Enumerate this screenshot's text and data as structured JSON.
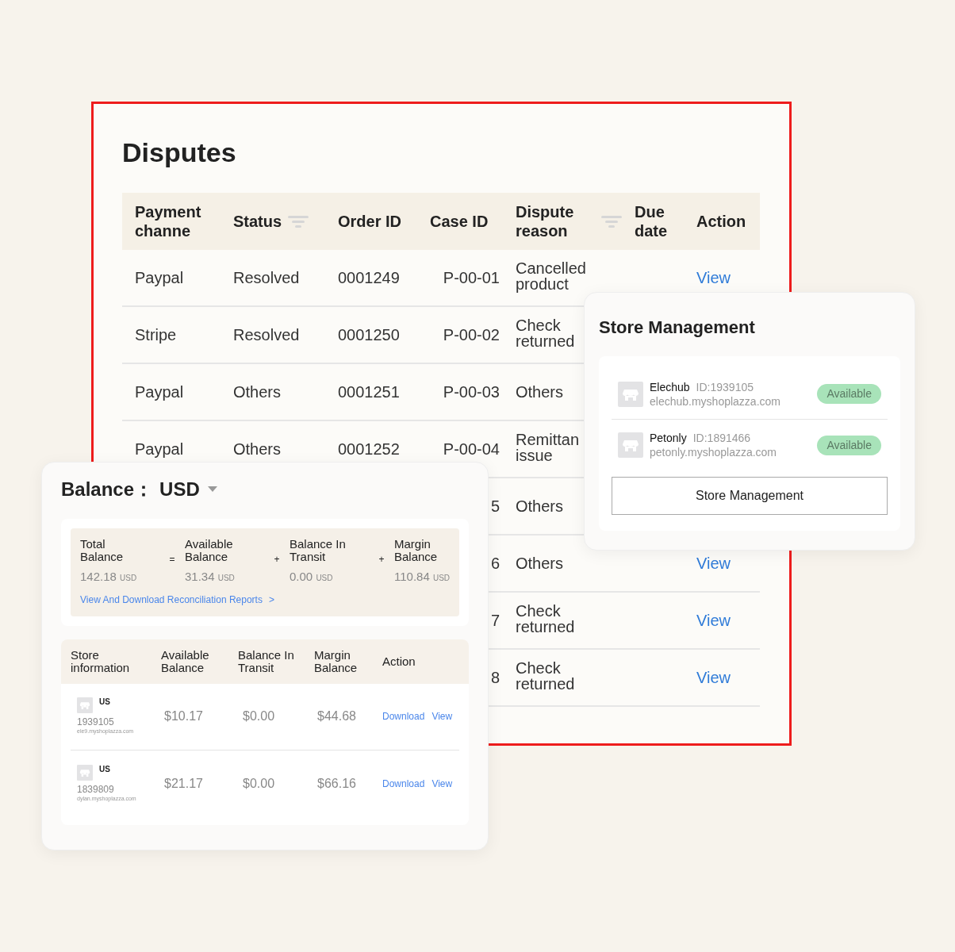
{
  "disputes": {
    "title": "Disputes",
    "columns": [
      {
        "label": "Payment channe",
        "filter": false
      },
      {
        "label": "Status",
        "filter": true
      },
      {
        "label": "Order ID",
        "filter": false
      },
      {
        "label": "Case ID",
        "filter": false
      },
      {
        "label": "Dispute reason",
        "filter": true
      },
      {
        "label": "Due date",
        "filter": false
      },
      {
        "label": "Action",
        "filter": false
      }
    ],
    "rows": [
      {
        "payment": "Paypal",
        "status": "Resolved",
        "order_id": "0001249",
        "case_id": "P-00-01",
        "reason": "Cancelled product",
        "action": "View"
      },
      {
        "payment": "Stripe",
        "status": "Resolved",
        "order_id": "0001250",
        "case_id": "P-00-02",
        "reason": "Check returned"
      },
      {
        "payment": "Paypal",
        "status": "Others",
        "order_id": "0001251",
        "case_id": "P-00-03",
        "reason": "Others"
      },
      {
        "payment": "Paypal",
        "status": "Others",
        "order_id": "0001252",
        "case_id": "P-00-04",
        "reason": "Remittan issue"
      },
      {
        "case_id": "5",
        "reason": "Others"
      },
      {
        "case_id": "6",
        "reason": "Others",
        "action": "View"
      },
      {
        "case_id": "7",
        "reason": "Check returned",
        "action": "View"
      },
      {
        "case_id": "8",
        "reason": "Check returned",
        "action": "View"
      }
    ]
  },
  "balance": {
    "title": "Balance：",
    "currency": "USD",
    "summary": [
      {
        "label": "Total Balance",
        "amount": "142.18",
        "unit": "USD"
      },
      {
        "operator": "=",
        "label": "Available Balance",
        "amount": "31.34",
        "unit": "USD"
      },
      {
        "operator": "+",
        "label": "Balance In Transit",
        "amount": "0.00",
        "unit": "USD"
      },
      {
        "operator": "+",
        "label": "Margin Balance",
        "amount": "110.84",
        "unit": "USD"
      }
    ],
    "report_link": "View And Download Reconciliation Reports",
    "report_arrow": ">",
    "columns": [
      "Store information",
      "Available Balance",
      "Balance In Transit",
      "Margin Balance",
      "Action"
    ],
    "rows": [
      {
        "region": "US",
        "store_id": "1939105",
        "domain": "ele9.myshoplazza.com",
        "available": "$10.17",
        "in_transit": "$0.00",
        "margin": "$44.68",
        "actions": [
          "Download",
          "View"
        ]
      },
      {
        "region": "US",
        "store_id": "1839809",
        "domain": "dylan.myshoplazza.com",
        "available": "$21.17",
        "in_transit": "$0.00",
        "margin": "$66.16",
        "actions": [
          "Download",
          "View"
        ]
      }
    ]
  },
  "store_management": {
    "title": "Store Management",
    "stores": [
      {
        "name": "Elechub",
        "id": "ID:1939105",
        "domain": "elechub.myshoplazza.com",
        "status": "Available"
      },
      {
        "name": "Petonly",
        "id": "ID:1891466",
        "domain": "petonly.myshoplazza.com",
        "status": "Available"
      }
    ],
    "button": "Store Management"
  }
}
